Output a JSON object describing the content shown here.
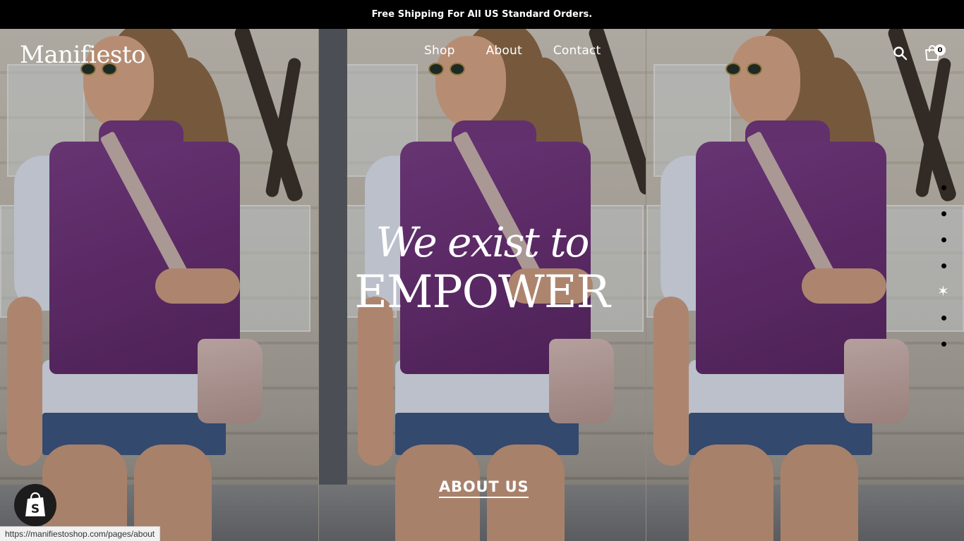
{
  "announcement": {
    "text": "Free Shipping For All US Standard Orders."
  },
  "header": {
    "logo": "Manifiesto",
    "nav": [
      {
        "label": "Shop"
      },
      {
        "label": "About"
      },
      {
        "label": "Contact"
      }
    ],
    "search_icon": "search-icon",
    "cart_icon": "shopping-bag-icon",
    "cart_count": "0"
  },
  "hero": {
    "tagline_line1": "We exist to",
    "tagline_line2": "EMPOWER",
    "cta_label": "ABOUT US",
    "slide_count": 7,
    "active_slide": 5
  },
  "shopify_badge": {
    "icon": "shopify-bag-icon"
  },
  "status_bar": {
    "url": "https://manifiestoshop.com/pages/about"
  },
  "colors": {
    "announcement_bg": "#000000",
    "text_light": "#ffffff",
    "sweater": "#6b3177"
  }
}
